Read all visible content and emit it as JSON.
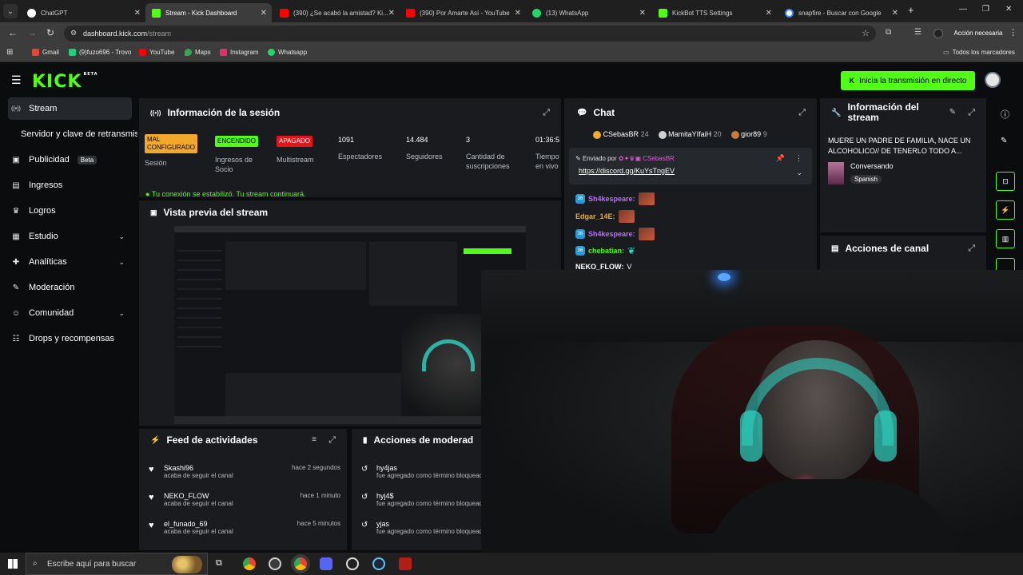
{
  "browser": {
    "tabs": [
      {
        "title": "ChatGPT",
        "color": "#ffffff"
      },
      {
        "title": "Stream - Kick Dashboard",
        "color": "#53fc18"
      },
      {
        "title": "(390) ¿Se acabó la amistad? Ki...",
        "color": "#ff0000"
      },
      {
        "title": "(390) Por Amarte Así - YouTube",
        "color": "#ff0000"
      },
      {
        "title": "(13) WhatsApp",
        "color": "#25d366"
      },
      {
        "title": "KickBot TTS Settings",
        "color": "#53fc18"
      },
      {
        "title": "snapfire - Buscar con Google",
        "color": "#4285f4"
      }
    ],
    "url_host": "dashboard.kick.com",
    "url_path": "/stream",
    "action_button": "Acción necesaria",
    "bookmarks": [
      {
        "label": "Gmail",
        "color": "#ea4335"
      },
      {
        "label": "(9)fuzo696 - Trovo",
        "color": "#1fd07a"
      },
      {
        "label": "YouTube",
        "color": "#ff0000"
      },
      {
        "label": "Maps",
        "color": "#34a853"
      },
      {
        "label": "Instagram",
        "color": "#e1306c"
      },
      {
        "label": "Whatsapp",
        "color": "#25d366"
      }
    ],
    "all_bookmarks": "Todos los marcadores"
  },
  "kick": {
    "logo": "KICK",
    "logo_tag": "BETA",
    "go_live": "Inicia la transmisión en directo",
    "accent": "#53fc18"
  },
  "sidebar": {
    "items": [
      {
        "label": "Stream",
        "icon": "radio-icon",
        "glyph": "((•))",
        "active": true
      },
      {
        "label": "Servidor y clave de retransmisión",
        "icon": "",
        "glyph": "",
        "active": false
      },
      {
        "label": "Publicidad",
        "icon": "ads-icon",
        "glyph": "▣",
        "badge": "Beta"
      },
      {
        "label": "Ingresos",
        "icon": "revenue-icon",
        "glyph": "▤"
      },
      {
        "label": "Logros",
        "icon": "trophy-icon",
        "glyph": "🏆"
      },
      {
        "label": "Estudio",
        "icon": "studio-icon",
        "glyph": "▦",
        "chevron": true
      },
      {
        "label": "Analíticas",
        "icon": "analytics-icon",
        "glyph": "✚",
        "chevron": true
      },
      {
        "label": "Moderación",
        "icon": "wrench-icon",
        "glyph": "✎"
      },
      {
        "label": "Comunidad",
        "icon": "community-icon",
        "glyph": "👥",
        "chevron": true
      },
      {
        "label": "Drops y recompensas",
        "icon": "drops-icon",
        "glyph": "☷"
      }
    ]
  },
  "session": {
    "title": "Información de la sesión",
    "stats": [
      {
        "badge": "MAL CONFIGURADO",
        "badge_bg": "#f2a92b",
        "badge_fg": "#000000",
        "label": "Sesión"
      },
      {
        "badge": "ENCENDIDO",
        "badge_bg": "#53fc18",
        "badge_fg": "#000000",
        "label": "Ingresos de Socio"
      },
      {
        "badge": "APAGADO",
        "badge_bg": "#e5141a",
        "badge_fg": "#ffffff",
        "label": "Multistream"
      },
      {
        "value": "1091",
        "label": "Espectadores"
      },
      {
        "value": "14.484",
        "label": "Seguidores"
      },
      {
        "value": "3",
        "label": "Cantidad de suscripciones"
      },
      {
        "value": "01:36:5",
        "label": "Tiempo en vivo"
      }
    ],
    "connection_notice": "Tu conexión se estabilizó. Tu stream continuará."
  },
  "preview": {
    "title": "Vista previa del stream"
  },
  "chat": {
    "title": "Chat",
    "top_gifters": [
      {
        "name": "CSebasBR",
        "count": "24",
        "color": "#f2a92b"
      },
      {
        "name": "MamitaYIfaiH",
        "count": "20",
        "color": "#d0d0d0"
      },
      {
        "name": "gior89",
        "count": "9",
        "color": "#c77b3a"
      }
    ],
    "pinned_by_label": "Enviado por",
    "pinned_by_user": "CSebasBR",
    "pinned_link": "https://discord.gg/KuYsTngEV",
    "messages": [
      {
        "user": "Sh4kespeare:",
        "color": "#c06bff",
        "sub": true
      },
      {
        "user": "Edgar_14E:",
        "color": "#f2a92b",
        "sub": false
      },
      {
        "user": "Sh4kespeare:",
        "color": "#c06bff",
        "sub": true
      },
      {
        "user": "chebatian:",
        "color": "#53fc18",
        "sub": true
      },
      {
        "user": "NEKO_FLOW:",
        "color": "#ffffff",
        "text": "V",
        "sub": false
      }
    ]
  },
  "stream_info": {
    "title": "Información del stream",
    "stream_title": "MUERE UN PADRE DE FAMILIA, NACE UN ALCOHOLICO// DE TENERLO TODO A...",
    "category": "Conversando",
    "language": "Spanish"
  },
  "channel_actions": {
    "title": "Acciones de canal"
  },
  "activity_feed": {
    "title": "Feed de actividades",
    "items": [
      {
        "name": "Skashi96",
        "desc": "acaba de seguir el canal",
        "time": "hace 2 segundos"
      },
      {
        "name": "NEKO_FLOW",
        "desc": "acaba de seguir el canal",
        "time": "hace 1 minuto"
      },
      {
        "name": "el_funado_69",
        "desc": "acaba de seguir el canal",
        "time": "hace 5 minutos"
      }
    ]
  },
  "mod_actions": {
    "title": "Acciones de moderad",
    "items": [
      {
        "name": "hy4jas",
        "desc": "fue agregado como término bloqueado"
      },
      {
        "name": "hyj4$",
        "desc": "fue agregado como término bloqueado"
      },
      {
        "name": "yjas",
        "desc": "fue agregado como término bloqueado"
      }
    ]
  },
  "taskbar": {
    "search_placeholder": "Escribe aquí para buscar"
  }
}
